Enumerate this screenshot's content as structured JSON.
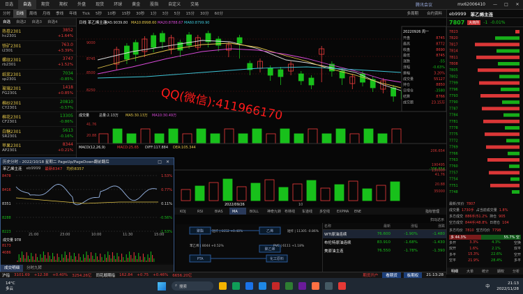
{
  "topbar": {
    "menus": [
      "日选",
      "自选",
      "期货",
      "期权",
      "外盘",
      "现货",
      "环球",
      "黄金",
      "股指",
      "自定义",
      "交易"
    ],
    "active": 1,
    "tabs_center": "腾讯会议",
    "account": "mx62006410",
    "window_buttons": [
      "—",
      "□",
      "✕"
    ]
  },
  "toolbar": {
    "items": [
      "分时",
      "日线",
      "周线",
      "月线",
      "季线",
      "年线",
      "Tick",
      "5秒",
      "10秒",
      "15秒",
      "30秒",
      "1分",
      "3分",
      "5分",
      "15分",
      "30分",
      "60分"
    ],
    "active": 1,
    "right_items": [
      "多周期",
      "合约资料"
    ]
  },
  "left": {
    "tabs": [
      "自选",
      "自选2",
      "自选3",
      "自选4"
    ],
    "quotes": [
      {
        "name": "热卷2301",
        "code": "hc2301",
        "price": "3852",
        "chg": "+1.64%",
        "dir": "up"
      },
      {
        "name": "铁矿2301",
        "code": "i2301",
        "price": "763.0",
        "chg": "+3.39%",
        "dir": "up"
      },
      {
        "name": "螺纹2301",
        "code": "rb2301",
        "price": "3747",
        "chg": "+1.52%",
        "dir": "up"
      },
      {
        "name": "纸浆2301",
        "code": "sp2301",
        "price": "7034",
        "chg": "-0.85%",
        "dir": "down"
      },
      {
        "name": "玻璃2301",
        "code": "FG2301",
        "price": "1418",
        "chg": "+0.85%",
        "dir": "up"
      },
      {
        "name": "棉纱2301",
        "code": "CY2301",
        "price": "20810",
        "chg": "-0.57%",
        "dir": "down"
      },
      {
        "name": "棉花2301",
        "code": "CF2301",
        "price": "13305",
        "chg": "-0.86%",
        "dir": "down"
      },
      {
        "name": "白糖2301",
        "code": "SR2301",
        "price": "5613",
        "chg": "-0.16%",
        "dir": "down"
      },
      {
        "name": "苹果2301",
        "code": "AP2301",
        "price": "8344",
        "chg": "+0.21%",
        "dir": "up"
      }
    ]
  },
  "main": {
    "title": "日线 苯乙烯主连",
    "ma_line": [
      "MA5:9039.80",
      "MA10:8998.60",
      "MA20:8788.67",
      "MA60:8799.90"
    ],
    "yaxis": [
      "9000",
      "8745",
      "8500",
      "8250"
    ],
    "info_panel": {
      "date": "20220926",
      "week": "周一",
      "rows": [
        [
          "开盘",
          "8745"
        ],
        [
          "最高",
          "8772"
        ],
        [
          "收盘",
          "8690"
        ],
        [
          "最低",
          "8745"
        ],
        [
          "涨跌",
          "-55"
        ],
        [
          "涨幅",
          "-0.63%"
        ],
        [
          "振幅",
          "3.20%"
        ],
        [
          "成交量",
          "55127"
        ],
        [
          "持仓",
          "8850"
        ],
        [
          "日增仓",
          "-3580"
        ],
        [
          "结算",
          "8766"
        ],
        [
          "成交额",
          "23.15万"
        ]
      ]
    },
    "watermark": "QQ(微信):411966170",
    "vol": {
      "label": "成交量",
      "ma": [
        "总量:2.13万",
        "MA5:30.13万",
        "MA10:30.49万"
      ],
      "y": [
        "41.76",
        "20.88"
      ]
    },
    "macd": {
      "label": "MACD(12,26,9)",
      "vals": [
        "MACD:25.65",
        "DIFF:117.884",
        "DEA:105.344"
      ],
      "y": [
        "206.654",
        "-206.654"
      ]
    },
    "sub": {
      "y": [
        "41.76",
        "20.88",
        "190495",
        "130000",
        "35000"
      ]
    },
    "xaxis": [
      "2022/09/26",
      "10"
    ],
    "indicator_tabs": [
      "KDJ",
      "RSI",
      "BIAS",
      "MA",
      "BOLL",
      "神奇九转",
      "布林线",
      "车道线",
      "多空线",
      "EXPMA",
      "ENE"
    ],
    "indicator_active": 3,
    "corner_btn": "指标管理"
  },
  "popup": {
    "title": "历史分时 - 2022/10/18 星期二 PageUp/PageDown翻前翻后",
    "subtitle": "苯乙烯主连",
    "code": "eb9999",
    "latest": "最新8347",
    "avg": "均价8357",
    "yleft": [
      "8478",
      "8416",
      "8351",
      "8288",
      "8223"
    ],
    "yright": [
      "1.53%",
      "0.77%",
      "0.11%",
      "-0.56%",
      "-1.53%"
    ],
    "times": [
      "21:00",
      "23:00",
      "10:00",
      "11:30",
      "15:00"
    ],
    "vol_label": "成交量",
    "vol_val": "978",
    "vol_y": [
      "8173",
      "4086"
    ],
    "tabs": [
      "成交明细",
      "分时九转"
    ],
    "close_buttons": [
      "□",
      "✕"
    ]
  },
  "flow": {
    "nodes": [
      "聚酯",
      "PTA",
      "乙烯",
      "聚乙烯",
      "化工原料"
    ],
    "labels": [
      "短纤 | 6652 +0.48%",
      "苯乙烯 | 8044 +0.52%",
      "PVC | 6111 +1.18%",
      "短纤 | 11305 -0.86%"
    ]
  },
  "table": {
    "headers": [
      "名称",
      "最新",
      "涨幅",
      "涨跌"
    ],
    "rows": [
      {
        "name": "WTI原油连续",
        "price": "76.600",
        "pct": "-1.90%",
        "chg": "-1.480",
        "active": true
      },
      {
        "name": "布伦特原油连续",
        "price": "83.910",
        "pct": "-1.68%",
        "chg": "-1.430",
        "active": false
      },
      {
        "name": "美原油主连",
        "price": "76.550",
        "pct": "-1.78%",
        "chg": "-1.390",
        "active": false
      }
    ],
    "corner": "扫马达示"
  },
  "right": {
    "code": "eb9999",
    "name": "苯乙烯主连",
    "price": "7807",
    "chg": "-1",
    "pct": "-0.01%",
    "tag": "大商所",
    "ladder": [
      "7823",
      "7820",
      "7817",
      "7814",
      "7811",
      "7808",
      "7805",
      "7802",
      "7799",
      "7796",
      "7793",
      "7790",
      "7787",
      "7784",
      "7781",
      "7778",
      "7775",
      "7772",
      "7769",
      "7766",
      "7763",
      "7760",
      "7757",
      "7754",
      "7751",
      "7748"
    ],
    "stats": [
      [
        "最新/买价",
        "7807"
      ],
      [
        "成交量",
        "1730手",
        "占当前成交量",
        "1.8%"
      ],
      [
        "多方成交",
        "886手/51.2%",
        "持仓",
        "905"
      ],
      [
        "空方成交",
        "844手/48.8%",
        "日增仓",
        "104"
      ]
    ],
    "side": {
      "a": "多方均价",
      "av": "7810",
      "b": "空方均价",
      "bv": "7798",
      "long": "多 44.3%",
      "long2": "55.7% 空"
    },
    "opens": [
      [
        "多开",
        "3.3%",
        "4.3%",
        "空换"
      ],
      [
        "双开",
        "1.6%",
        "2.1%",
        "双平"
      ],
      [
        "多平",
        "15.3%",
        "22.6%",
        "空开"
      ],
      [
        "空平",
        "21.9%",
        "28.4%",
        "多平"
      ]
    ],
    "bottom_tabs": [
      "明细",
      "大单",
      "统计",
      "期权",
      "分析"
    ]
  },
  "status": {
    "index": "沪指",
    "index_val": "3101.69",
    "index_chg": "+12.38",
    "index_pct": "+0.40%",
    "amount": "3254.26亿",
    "other": "同花顺期指",
    "other_val": "162.84",
    "other_chg": "+0.75",
    "other_pct": "+0.46%",
    "other_amt": "6656.20亿",
    "brand": "期货开户",
    "btn1": "看期货",
    "btn2": "板期权",
    "time": "21:13:28"
  },
  "taskbar": {
    "weather": "14°C",
    "weather_desc": "多云",
    "search": "搜索",
    "clock": "21:13",
    "date": "2022/11/28",
    "lang": "中"
  },
  "colors": {
    "up": "#f23c3c",
    "down": "#18c01b",
    "accent": "#e6c84a",
    "ma5": "#dddddd",
    "ma10": "#e6c84a",
    "ma20": "#d84ad8",
    "ma60": "#3fc6d8"
  }
}
